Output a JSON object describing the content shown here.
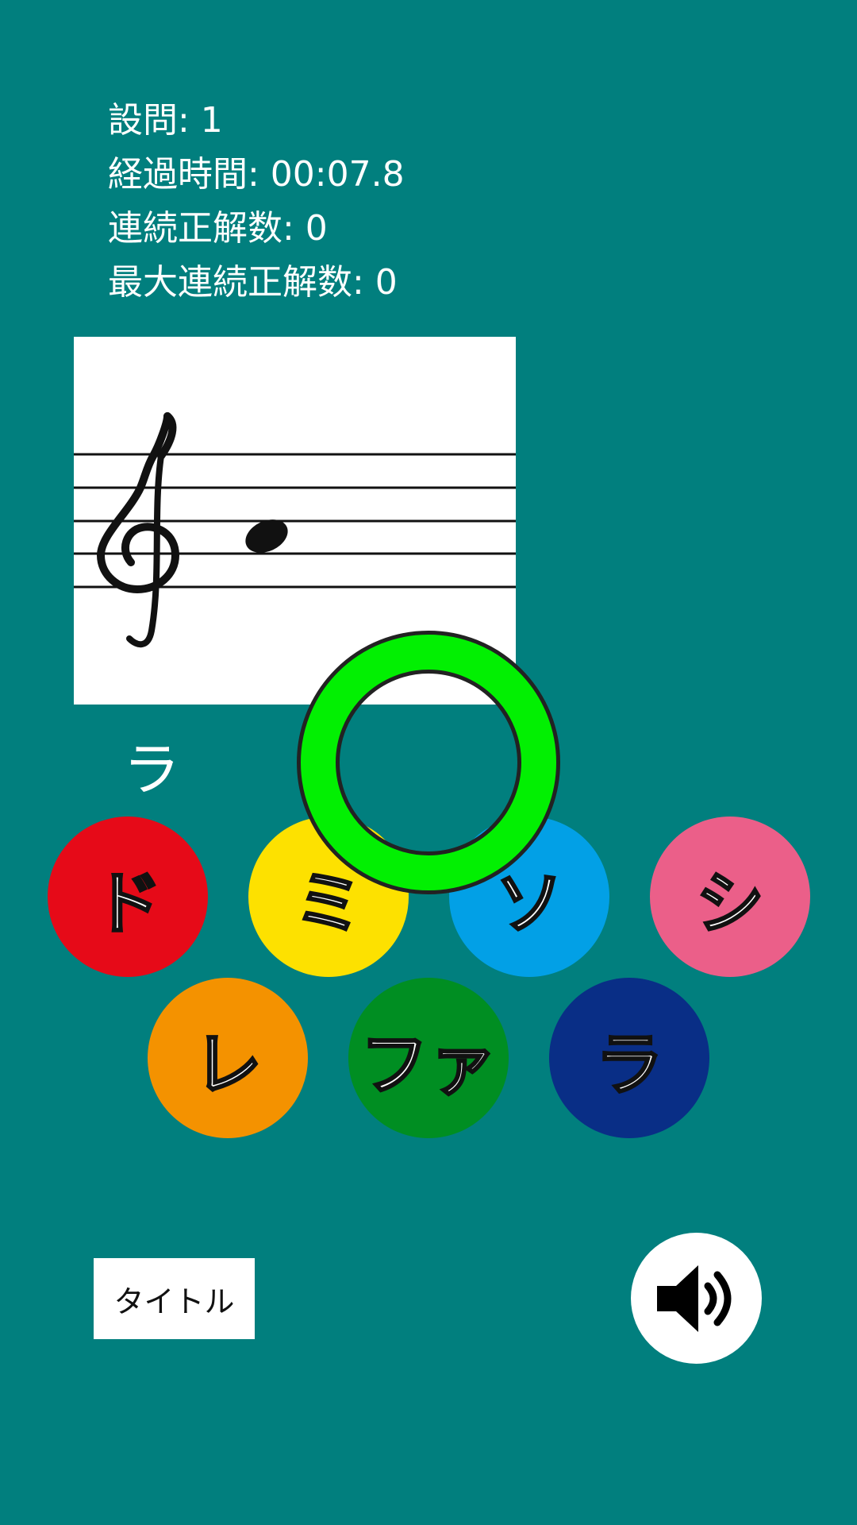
{
  "stats": {
    "question": "設問: 1",
    "elapsed": "経過時間: 00:07.8",
    "streak": "連続正解数: 0",
    "max_streak": "最大連続正解数: 0"
  },
  "staff": {
    "clef": "treble-clef",
    "note": "ラ"
  },
  "answer_label": "ラ",
  "result_icon": "correct-circle-icon",
  "notes": [
    {
      "label": "ド",
      "color": "#e60a18"
    },
    {
      "label": "ミ",
      "color": "#fde100"
    },
    {
      "label": "ソ",
      "color": "#02a0e6"
    },
    {
      "label": "シ",
      "color": "#eb5f89"
    },
    {
      "label": "レ",
      "color": "#f49200"
    },
    {
      "label": "ファ",
      "color": "#008e22"
    },
    {
      "label": "ラ",
      "color": "#092e86"
    }
  ],
  "title_button": "タイトル",
  "sound_icon": "speaker-icon"
}
